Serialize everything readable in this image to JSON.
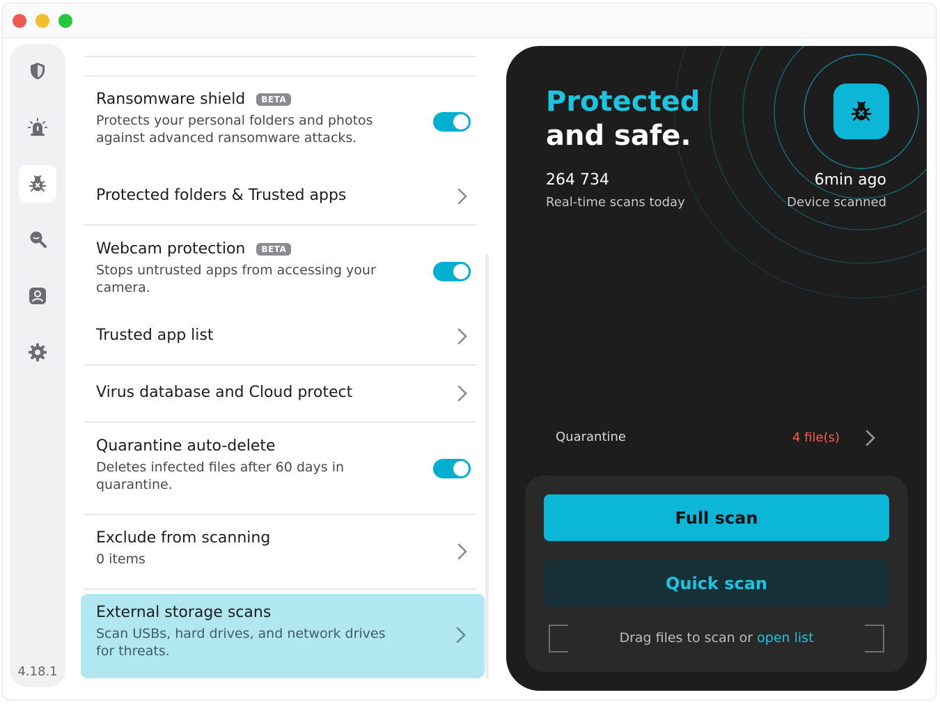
{
  "sidebar": {
    "items": [
      {
        "icon": "shield-icon"
      },
      {
        "icon": "alarm-icon"
      },
      {
        "icon": "bug-icon"
      },
      {
        "icon": "search-icon"
      },
      {
        "icon": "user-icon"
      },
      {
        "icon": "gear-icon"
      }
    ],
    "version": "4.18.1"
  },
  "settings": {
    "ransomware": {
      "title": "Ransomware shield",
      "badge": "BETA",
      "desc": "Protects your personal folders and photos against advanced ransomware attacks.",
      "enabled": true
    },
    "protected_folders": {
      "title": "Protected folders & Trusted apps"
    },
    "webcam": {
      "title": "Webcam protection",
      "badge": "BETA",
      "desc": "Stops untrusted apps from accessing your camera.",
      "enabled": true
    },
    "trusted_apps": {
      "title": "Trusted app list"
    },
    "virus_db": {
      "title": "Virus database and Cloud protect"
    },
    "quarantine_delete": {
      "title": "Quarantine auto-delete",
      "desc": "Deletes infected files after 60 days in quarantine.",
      "enabled": true
    },
    "exclude": {
      "title": "Exclude from scanning",
      "desc": "0 items"
    },
    "external": {
      "title": "External storage scans",
      "desc": "Scan USBs, hard drives, and network drives for threats."
    }
  },
  "panel": {
    "status_line1": "Protected",
    "status_line2": "and safe.",
    "scans_value": "264 734",
    "scans_label": "Real-time scans today",
    "last_scan_value": "6min ago",
    "last_scan_label": "Device scanned",
    "quarantine_label": "Quarantine",
    "quarantine_count": "4 file(s)",
    "full_scan": "Full scan",
    "quick_scan": "Quick scan",
    "drop_text": "Drag files to scan or",
    "drop_link": "open list"
  },
  "colors": {
    "accent": "#0cb6d6",
    "accent_text": "#1ec3e0",
    "panel_bg": "#1d1d1d",
    "alert": "#ff5b52",
    "highlight": "#b0e7f0"
  }
}
